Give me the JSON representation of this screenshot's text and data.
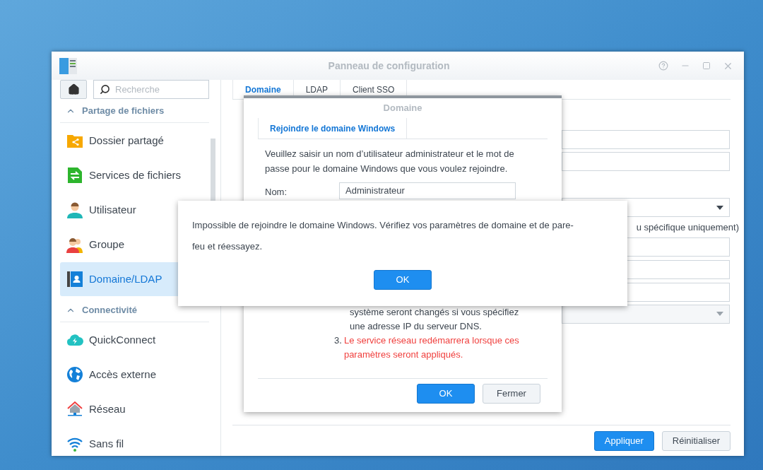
{
  "window": {
    "title": "Panneau de configuration"
  },
  "sidebar": {
    "search_placeholder": "Recherche",
    "sections": [
      {
        "title": "Partage de fichiers",
        "expanded": true,
        "items": [
          {
            "label": "Dossier partagé",
            "kind": "folder",
            "selected": false
          },
          {
            "label": "Services de fichiers",
            "kind": "transfer",
            "selected": false
          },
          {
            "label": "Utilisateur",
            "kind": "user",
            "selected": false
          },
          {
            "label": "Groupe",
            "kind": "group",
            "selected": false
          },
          {
            "label": "Domaine/LDAP",
            "kind": "directory",
            "selected": true
          }
        ]
      },
      {
        "title": "Connectivité",
        "expanded": true,
        "items": [
          {
            "label": "QuickConnect",
            "kind": "cloud",
            "selected": false
          },
          {
            "label": "Accès externe",
            "kind": "globe",
            "selected": false
          },
          {
            "label": "Réseau",
            "kind": "network",
            "selected": false
          },
          {
            "label": "Sans fil",
            "kind": "wireless",
            "selected": false
          }
        ]
      }
    ]
  },
  "tabs": [
    {
      "label": "Domaine",
      "selected": true
    },
    {
      "label": "LDAP",
      "selected": false
    },
    {
      "label": "Client SSO",
      "selected": false
    }
  ],
  "settings_rows": [
    {
      "kind": "field"
    },
    {
      "kind": "field"
    },
    {
      "kind": "dropdown",
      "disabled": false
    },
    {
      "kind": "note",
      "text": "u spécifique uniquement)"
    },
    {
      "kind": "field"
    },
    {
      "kind": "field"
    },
    {
      "kind": "field"
    },
    {
      "kind": "dropdown",
      "disabled": true
    }
  ],
  "footer_buttons": [
    {
      "label": "Appliquer",
      "primary": true
    },
    {
      "label": "Réinitialiser",
      "primary": false
    }
  ],
  "domain_dialog": {
    "title": "Domaine",
    "tabs": [
      {
        "label": "Rejoindre le domaine Windows",
        "selected": true
      }
    ],
    "intro": "Veuillez saisir un nom d’utilisateur administrateur et le mot de passe pour le domaine Windows que vous voulez rejoindre.",
    "name_label": "Nom:",
    "name_value": "Administrateur",
    "notes": [
      {
        "text": "système seront changés si vous spécifiez une adresse IP du serveur DNS.",
        "warning": false
      },
      {
        "number": "3.",
        "text": "Le service réseau redémarrera lorsque ces paramètres seront appliqués.",
        "warning": true
      }
    ],
    "buttons": [
      {
        "label": "OK",
        "primary": true
      },
      {
        "label": "Fermer",
        "primary": false
      }
    ]
  },
  "alert": {
    "message": "Impossible de rejoindre le domaine Windows. Vérifiez vos paramètres de domaine et de pare-feu et réessayez.",
    "button": "OK"
  }
}
